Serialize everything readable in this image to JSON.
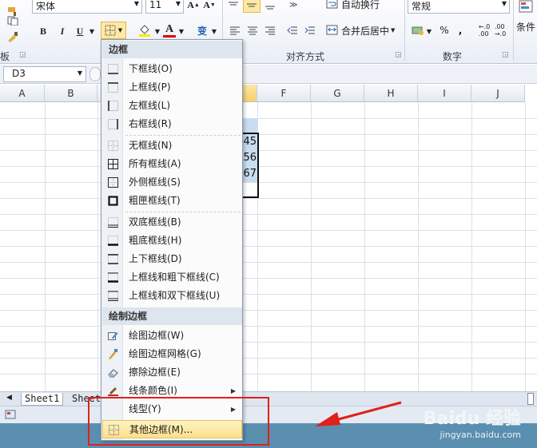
{
  "ribbon": {
    "font_name": "宋体",
    "font_size": "11",
    "bold": "B",
    "italic": "I",
    "underline": "U",
    "font_color_letter": "A",
    "phonetic": "变",
    "wrap_text": "自动换行",
    "merge_center": "合并后居中",
    "number_format": "常规",
    "percent": "%",
    "comma": ",",
    "conditional": "条件",
    "group_alignment": "对齐方式",
    "group_number": "数字",
    "group_clipboard": "板"
  },
  "formula_bar": {
    "name_box": "D3"
  },
  "grid": {
    "columns": [
      "A",
      "B",
      "C",
      "D",
      "E",
      "F",
      "G",
      "H",
      "I",
      "J"
    ],
    "values": [
      "45",
      "56",
      "67"
    ]
  },
  "menu": {
    "header_border": "边框",
    "items_border": [
      {
        "label": "下框线(O)",
        "icon": "bottom-border-icon"
      },
      {
        "label": "上框线(P)",
        "icon": "top-border-icon"
      },
      {
        "label": "左框线(L)",
        "icon": "left-border-icon"
      },
      {
        "label": "右框线(R)",
        "icon": "right-border-icon"
      },
      {
        "label": "无框线(N)",
        "icon": "no-border-icon"
      },
      {
        "label": "所有框线(A)",
        "icon": "all-borders-icon"
      },
      {
        "label": "外侧框线(S)",
        "icon": "outside-borders-icon"
      },
      {
        "label": "粗匣框线(T)",
        "icon": "thick-box-border-icon"
      },
      {
        "label": "双底框线(B)",
        "icon": "double-bottom-border-icon"
      },
      {
        "label": "粗底框线(H)",
        "icon": "thick-bottom-border-icon"
      },
      {
        "label": "上下框线(D)",
        "icon": "top-bottom-border-icon"
      },
      {
        "label": "上框线和粗下框线(C)",
        "icon": "top-thick-bottom-border-icon"
      },
      {
        "label": "上框线和双下框线(U)",
        "icon": "top-double-bottom-border-icon"
      }
    ],
    "header_draw": "绘制边框",
    "items_draw": [
      {
        "label": "绘图边框(W)",
        "icon": "draw-border-icon"
      },
      {
        "label": "绘图边框网格(G)",
        "icon": "draw-border-grid-icon"
      },
      {
        "label": "擦除边框(E)",
        "icon": "erase-border-icon"
      },
      {
        "label": "线条颜色(I)",
        "icon": "line-color-icon"
      },
      {
        "label": "线型(Y)",
        "icon": "line-style-icon"
      },
      {
        "label": "其他边框(M)...",
        "icon": "more-borders-icon"
      }
    ]
  },
  "sheets": {
    "tab1": "Sheet1",
    "tab2": "Sheet"
  },
  "watermark": {
    "logo": "Baidu 经验",
    "url": "jingyan.baidu.com"
  },
  "colors": {
    "highlight": "#fde08c",
    "annotation_red": "#e0201b",
    "cell_fill": "#c9ddf1"
  }
}
